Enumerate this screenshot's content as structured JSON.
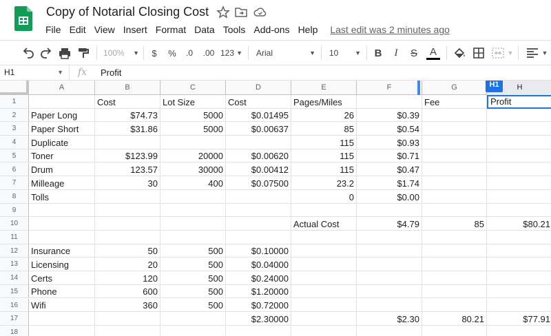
{
  "document": {
    "title": "Copy of Notarial Closing Cost",
    "last_edit": "Last edit was 2 minutes ago"
  },
  "menu": [
    "File",
    "Edit",
    "View",
    "Insert",
    "Format",
    "Data",
    "Tools",
    "Add-ons",
    "Help"
  ],
  "toolbar": {
    "zoom": "100%",
    "currency": "$",
    "percent": "%",
    "decrease_decimal": ".0",
    "increase_decimal": ".00",
    "more_formats": "123",
    "font": "Arial",
    "font_size": "10",
    "bold": "B",
    "italic": "I",
    "strikethrough": "S",
    "text_color": "A",
    "accent_color": "#1a73e8",
    "logo_color": "#0f9d58"
  },
  "formula_bar": {
    "cell_ref": "H1",
    "fx": "fx",
    "value": "Profit"
  },
  "selected_cell_tag": "H1",
  "columns": [
    "A",
    "B",
    "C",
    "D",
    "E",
    "F",
    "G",
    "H"
  ],
  "rows": [
    "1",
    "2",
    "3",
    "4",
    "5",
    "6",
    "7",
    "8",
    "9",
    "10",
    "11",
    "12",
    "13",
    "14",
    "15",
    "16",
    "17",
    "18"
  ],
  "cells": [
    [
      "",
      "Cost",
      "Lot Size",
      "Cost",
      "Pages/Miles",
      "",
      "Fee",
      "Profit"
    ],
    [
      "Paper Long",
      "$74.73",
      "5000",
      "$0.01495",
      "26",
      "$0.39",
      "",
      ""
    ],
    [
      "Paper Short",
      "$31.86",
      "5000",
      "$0.00637",
      "85",
      "$0.54",
      "",
      ""
    ],
    [
      "Duplicate",
      "",
      "",
      "",
      "115",
      "$0.93",
      "",
      ""
    ],
    [
      "Toner",
      "$123.99",
      "20000",
      "$0.00620",
      "115",
      "$0.71",
      "",
      ""
    ],
    [
      "Drum",
      "123.57",
      "30000",
      "$0.00412",
      "115",
      "$0.47",
      "",
      ""
    ],
    [
      "Milleage",
      "30",
      "400",
      "$0.07500",
      "23.2",
      "$1.74",
      "",
      ""
    ],
    [
      "Tolls",
      "",
      "",
      "",
      "0",
      "$0.00",
      "",
      ""
    ],
    [
      "",
      "",
      "",
      "",
      "",
      "",
      "",
      ""
    ],
    [
      "",
      "",
      "",
      "",
      "Actual Cost",
      "$4.79",
      "85",
      "$80.21"
    ],
    [
      "",
      "",
      "",
      "",
      "",
      "",
      "",
      ""
    ],
    [
      "Insurance",
      "50",
      "500",
      "$0.10000",
      "",
      "",
      "",
      ""
    ],
    [
      "Licensing",
      "20",
      "500",
      "$0.04000",
      "",
      "",
      "",
      ""
    ],
    [
      "Certs",
      "120",
      "500",
      "$0.24000",
      "",
      "",
      "",
      ""
    ],
    [
      "Phone",
      "600",
      "500",
      "$1.20000",
      "",
      "",
      "",
      ""
    ],
    [
      "Wifi",
      "360",
      "500",
      "$0.72000",
      "",
      "",
      "",
      ""
    ],
    [
      "",
      "",
      "",
      "$2.30000",
      "",
      "$2.30",
      "80.21",
      "$77.91"
    ],
    [
      "",
      "",
      "",
      "",
      "",
      "",
      "",
      ""
    ]
  ],
  "cell_align": [
    [
      "l",
      "l",
      "l",
      "l",
      "l",
      "l",
      "l",
      "l"
    ],
    [
      "l",
      "r",
      "r",
      "r",
      "r",
      "r",
      "r",
      "r"
    ],
    [
      "l",
      "r",
      "r",
      "r",
      "r",
      "r",
      "r",
      "r"
    ],
    [
      "l",
      "r",
      "r",
      "r",
      "r",
      "r",
      "r",
      "r"
    ],
    [
      "l",
      "r",
      "r",
      "r",
      "r",
      "r",
      "r",
      "r"
    ],
    [
      "l",
      "r",
      "r",
      "r",
      "r",
      "r",
      "r",
      "r"
    ],
    [
      "l",
      "r",
      "r",
      "r",
      "r",
      "r",
      "r",
      "r"
    ],
    [
      "l",
      "r",
      "r",
      "r",
      "r",
      "r",
      "r",
      "r"
    ],
    [
      "l",
      "r",
      "r",
      "r",
      "r",
      "r",
      "r",
      "r"
    ],
    [
      "l",
      "r",
      "r",
      "r",
      "l",
      "r",
      "r",
      "r"
    ],
    [
      "l",
      "r",
      "r",
      "r",
      "r",
      "r",
      "r",
      "r"
    ],
    [
      "l",
      "r",
      "r",
      "r",
      "r",
      "r",
      "r",
      "r"
    ],
    [
      "l",
      "r",
      "r",
      "r",
      "r",
      "r",
      "r",
      "r"
    ],
    [
      "l",
      "r",
      "r",
      "r",
      "r",
      "r",
      "r",
      "r"
    ],
    [
      "l",
      "r",
      "r",
      "r",
      "r",
      "r",
      "r",
      "r"
    ],
    [
      "l",
      "r",
      "r",
      "r",
      "r",
      "r",
      "r",
      "r"
    ],
    [
      "l",
      "r",
      "r",
      "r",
      "r",
      "r",
      "r",
      "r"
    ],
    [
      "l",
      "r",
      "r",
      "r",
      "r",
      "r",
      "r",
      "r"
    ]
  ]
}
